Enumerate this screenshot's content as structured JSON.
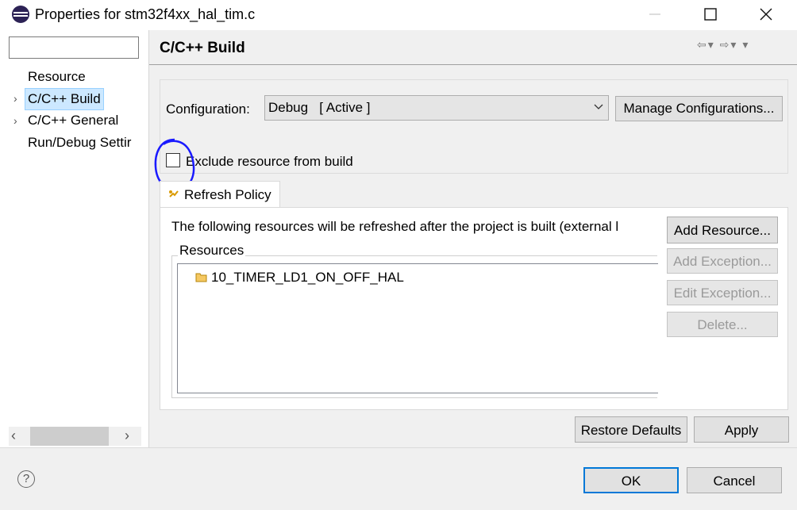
{
  "window": {
    "title": "Properties for stm32f4xx_hal_tim.c",
    "minimize_icon": "minimize-icon",
    "maximize_icon": "maximize-icon",
    "close_icon": "close-icon"
  },
  "sidebar": {
    "filter_value": "",
    "items": [
      {
        "label": "Resource",
        "expandable": false,
        "selected": false
      },
      {
        "label": "C/C++ Build",
        "expandable": true,
        "selected": true
      },
      {
        "label": "C/C++ General",
        "expandable": true,
        "selected": false
      },
      {
        "label": "Run/Debug Settir",
        "expandable": false,
        "selected": false
      }
    ]
  },
  "page": {
    "title": "C/C++ Build"
  },
  "configuration": {
    "label": "Configuration:",
    "selected": "Debug   [ Active ]",
    "manage_label": "Manage Configurations..."
  },
  "exclude": {
    "label": "Exclude resource from build",
    "checked": false
  },
  "tabs": [
    {
      "label": "Refresh Policy",
      "icon": "refresh-policy-icon",
      "active": true
    }
  ],
  "refresh": {
    "description": "The following resources will be refreshed after the project is built (external l",
    "resources_label": "Resources",
    "items": [
      "10_TIMER_LD1_ON_OFF_HAL"
    ],
    "buttons": {
      "add_resource": "Add Resource...",
      "add_exception": "Add Exception...",
      "edit_exception": "Edit Exception...",
      "delete": "Delete..."
    }
  },
  "actions": {
    "restore_defaults": "Restore Defaults",
    "apply": "Apply",
    "ok": "OK",
    "cancel": "Cancel"
  },
  "colors": {
    "selection": "#cce8ff",
    "annotation": "#1a1aff",
    "default_button_border": "#0078d7"
  }
}
